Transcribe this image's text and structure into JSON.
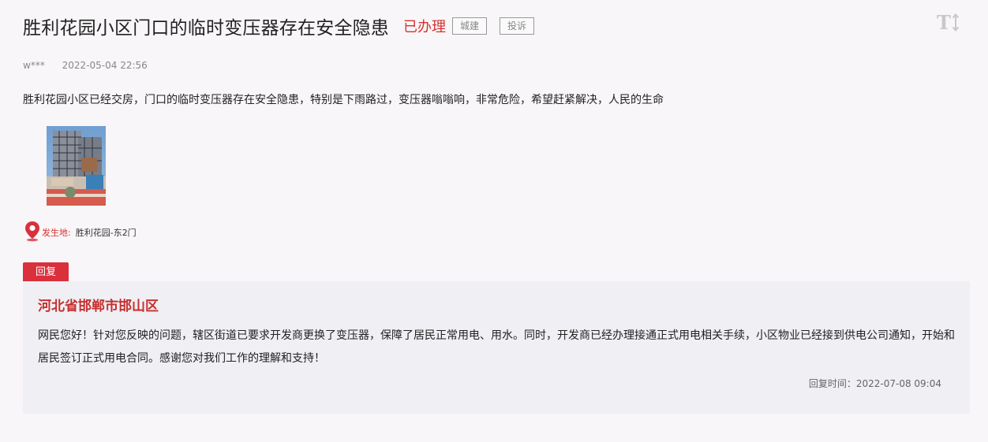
{
  "post": {
    "title": "胜利花园小区门口的临时变压器存在安全隐患",
    "status": "已办理",
    "tags": [
      "城建",
      "投诉"
    ],
    "author": "w***",
    "date": "2022-05-04 22:56",
    "content": "胜利花园小区已经交房，门口的临时变压器存在安全隐患，特别是下雨路过，变压器嗡嗡响，非常危险，希望赶紧解决，人民的生命",
    "location_label": "发生地:",
    "location_value": "胜利花园-东2门"
  },
  "toolbar": {
    "font_size_icon": "text-size-icon"
  },
  "reply": {
    "tab_label": "回复",
    "org": "河北省邯郸市邯山区",
    "text": " 网民您好！针对您反映的问题，辖区街道已要求开发商更换了变压器，保障了居民正常用电、用水。同时，开发商已经办理接通正式用电相关手续，小区物业已经接到供电公司通知，开始和居民签订正式用电合同。感谢您对我们工作的理解和支持！",
    "time_label": "回复时间：2022-07-08 09:04"
  },
  "colors": {
    "accent": "#d9302f",
    "reply_tab": "#d9303b",
    "reply_bg": "#efeff4",
    "page_bg": "#f8f6f8"
  }
}
